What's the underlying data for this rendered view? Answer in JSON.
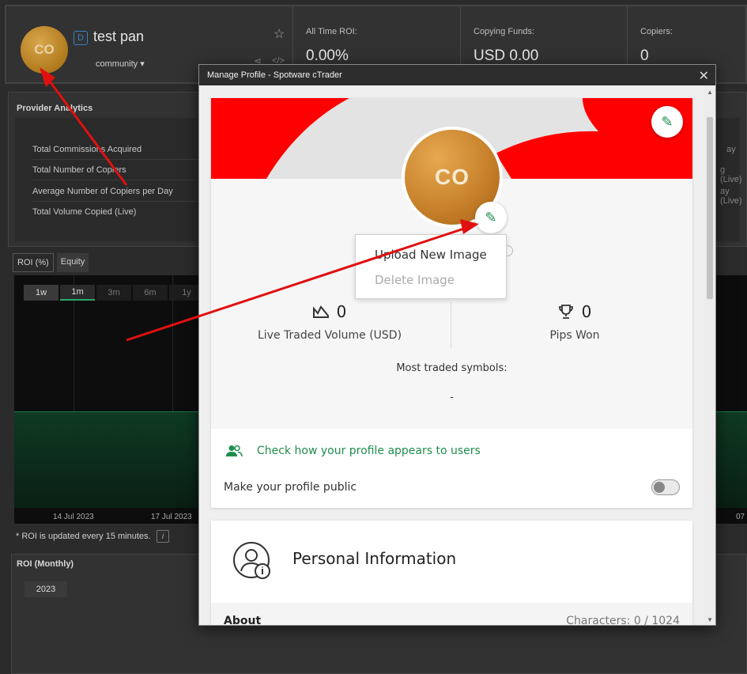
{
  "header": {
    "avatar_initials": "CO",
    "badge": "D",
    "name": "test pan",
    "community": "community ▾",
    "stats": [
      {
        "label": "All Time ROI:",
        "value": "0.00%"
      },
      {
        "label": "Copying Funds:",
        "value": "USD 0.00"
      },
      {
        "label": "Copiers:",
        "value": "0"
      }
    ]
  },
  "analytics": {
    "title": "Provider Analytics",
    "rows": [
      "Total Commissions Acquired",
      "Total Number of Copiers",
      "Average Number of Copiers per Day",
      "Total Volume Copied (Live)"
    ],
    "right_fragments": [
      "ay",
      "g (Live)",
      "ay (Live)"
    ]
  },
  "roi_tabs": [
    "ROI (%)",
    "Equity"
  ],
  "ranges": [
    "1w",
    "1m",
    "3m",
    "6m",
    "1y"
  ],
  "x_axis": [
    "14 Jul 2023",
    "17 Jul 2023",
    "07"
  ],
  "roi_note": "* ROI is updated every 15 minutes.",
  "roi_info": "i",
  "monthly": {
    "title": "ROI (Monthly)",
    "year": "2023"
  },
  "modal": {
    "title": "Manage Profile - Spotware cTrader",
    "close": "✕",
    "avatar_initials": "CO",
    "menu": {
      "upload": "Upload New Image",
      "delete": "Delete Image"
    },
    "metrics": [
      {
        "value": "0",
        "caption": "Live Traded Volume (USD)"
      },
      {
        "value": "0",
        "caption": "Pips Won"
      }
    ],
    "most_traded_label": "Most traded symbols:",
    "most_traded_value": "-",
    "check_link": "Check how your profile appears to users",
    "public_label": "Make your profile public",
    "personal_title": "Personal Information",
    "about_label": "About",
    "about_count": "Characters: 0 / 1024"
  },
  "colors": {
    "accent_green": "#1e8e4e",
    "cover_red": "#ff0000",
    "arrow_red": "#e01010"
  }
}
